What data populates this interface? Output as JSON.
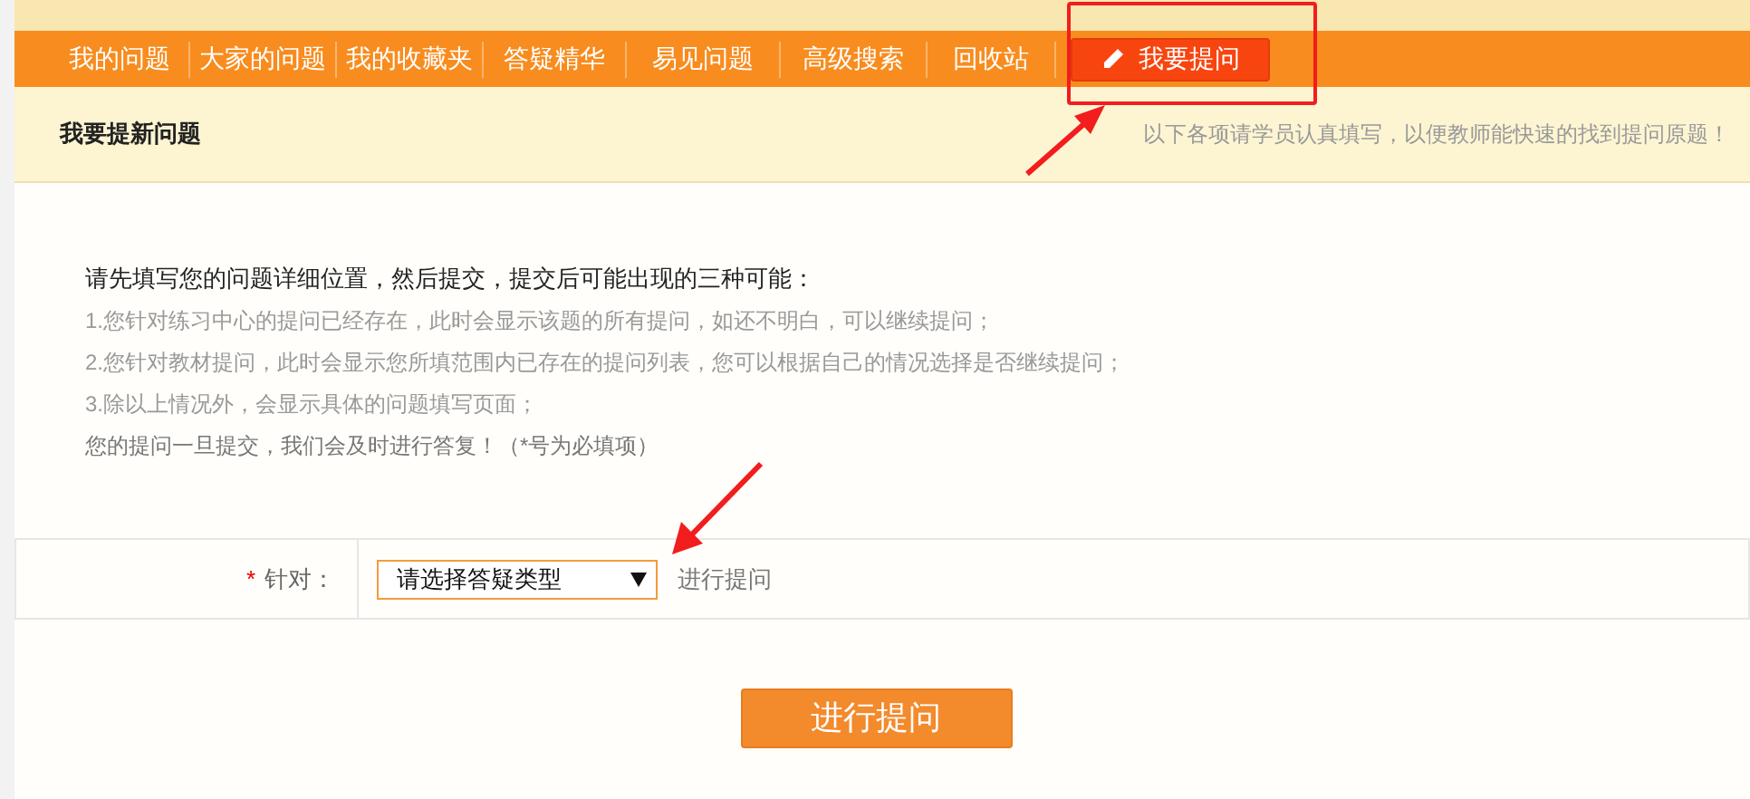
{
  "nav": {
    "items": [
      {
        "label": "我的问题",
        "selected": false,
        "kind": "link"
      },
      {
        "label": "大家的问题",
        "selected": false,
        "kind": "link"
      },
      {
        "label": "我的收藏夹",
        "selected": false,
        "kind": "link"
      },
      {
        "label": "答疑精华",
        "selected": false,
        "kind": "link"
      },
      {
        "label": "易见问题",
        "selected": false,
        "kind": "link"
      },
      {
        "label": "高级搜索",
        "selected": false,
        "kind": "link"
      },
      {
        "label": "回收站",
        "selected": false,
        "kind": "link"
      },
      {
        "label": "我要提问",
        "selected": true,
        "kind": "button"
      }
    ]
  },
  "header": {
    "title": "我要提新问题",
    "hint": "以下各项请学员认真填写，以便教师能快速的找到提问原题！"
  },
  "intro": {
    "heading": "请先填写您的问题详细位置，然后提交，提交后可能出现的三种可能：",
    "items": [
      "1.您针对练习中心的提问已经存在，此时会显示该题的所有提问，如还不明白，可以继续提问；",
      "2.您针对教材提问，此时会显示您所填范围内已存在的提问列表，您可以根据自己的情况选择是否继续提问；",
      "3.除以上情况外，会显示具体的问题填写页面；"
    ],
    "note": "您的提问一旦提交，我们会及时进行答复！（*号为必填项）"
  },
  "form": {
    "required_mark": "*",
    "label": "针对：",
    "select": {
      "value": "请选择答疑类型"
    },
    "suffix": "进行提问"
  },
  "submit": "进行提问"
}
